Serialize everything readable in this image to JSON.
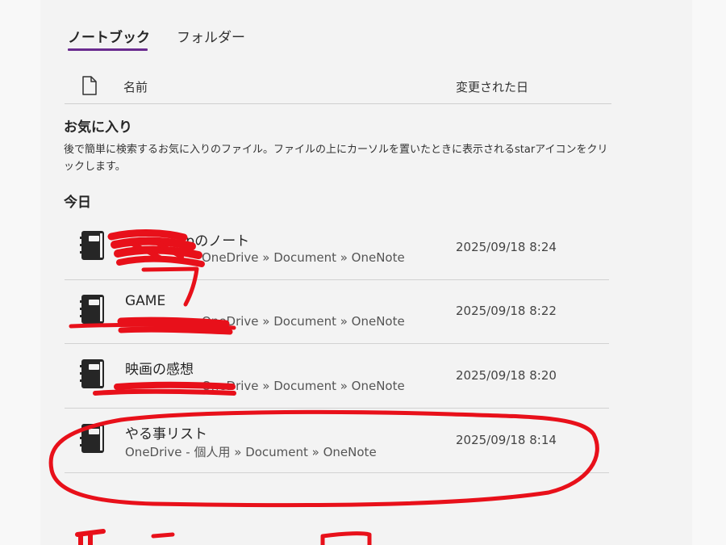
{
  "tabs": [
    {
      "label": "ノートブック",
      "active": true
    },
    {
      "label": "フォルダー",
      "active": false
    }
  ],
  "columns": {
    "name": "名前",
    "date": "変更された日"
  },
  "favorites": {
    "title": "お気に入り",
    "description": "後で簡単に検索するお気に入りのファイル。ファイルの上にカーソルを置いたときに表示されるstarアイコンをクリックします。"
  },
  "today": {
    "title": "今日",
    "items": [
      {
        "title": "apのノート",
        "path": "OneDrive » Document » OneNote",
        "date": "2025/09/18 8:24"
      },
      {
        "title": "GAME",
        "path": "OneDrive » Document » OneNote",
        "date": "2025/09/18 8:22"
      },
      {
        "title": "映画の感想",
        "path": "OneDrive » Document » OneNote",
        "date": "2025/09/18 8:20"
      },
      {
        "title": "やる事リスト",
        "path": "OneDrive - 個人用 » Document » OneNote",
        "date": "2025/09/18 8:14"
      }
    ]
  },
  "colors": {
    "accent": "#6a2b8f",
    "annotation": "#e8101a"
  },
  "icons": {
    "file_header": "file-icon",
    "notebook": "notebook-icon"
  }
}
